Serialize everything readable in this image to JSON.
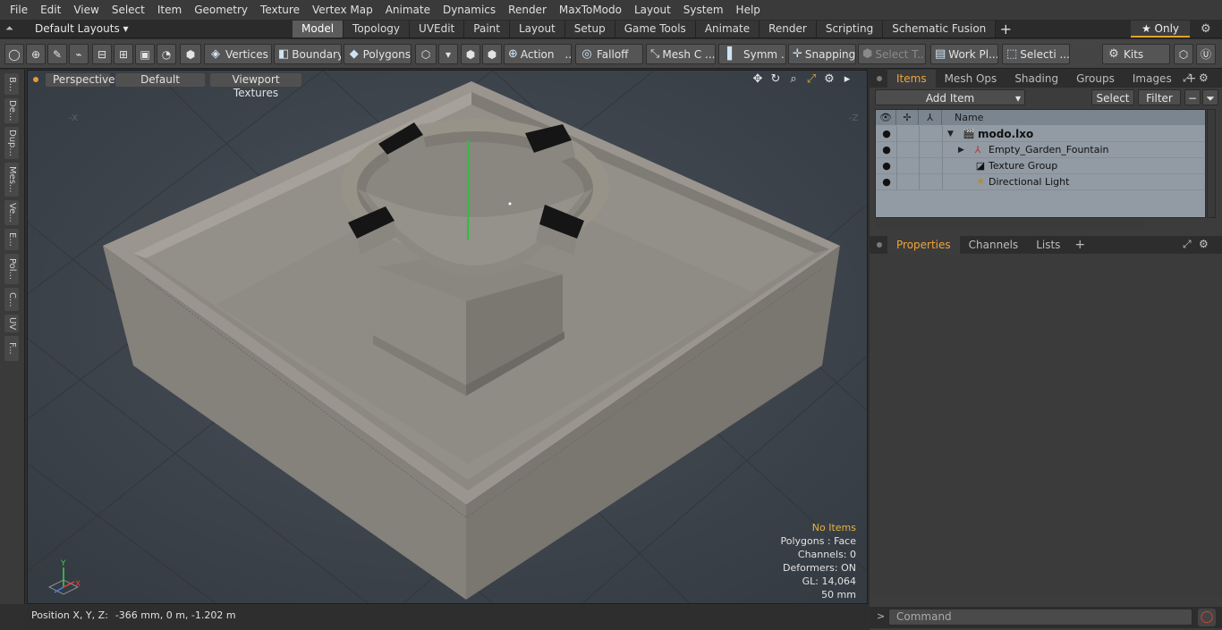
{
  "menu": [
    "File",
    "Edit",
    "View",
    "Select",
    "Item",
    "Geometry",
    "Texture",
    "Vertex Map",
    "Animate",
    "Dynamics",
    "Render",
    "MaxToModo",
    "Layout",
    "System",
    "Help"
  ],
  "layout_selector": "Default Layouts ▾",
  "layout_tabs": [
    "Model",
    "Topology",
    "UVEdit",
    "Paint",
    "Layout",
    "Setup",
    "Game Tools",
    "Animate",
    "Render",
    "Scripting",
    "Schematic Fusion"
  ],
  "layout_tab_add": "+",
  "only_button": "★  Only",
  "toolbar": {
    "vertices": "Vertices",
    "boundary": "Boundary",
    "polygons": "Polygons",
    "action": "Action",
    "action_more": "...",
    "falloff": "Falloff",
    "mesh": "Mesh C ...",
    "symmetry": "Symm ...",
    "snapping": "Snapping",
    "select_through": "Select T...",
    "work_plane": "Work Pl...",
    "selection": "Selecti ...",
    "kits": "Kits"
  },
  "left_strip": [
    "B...",
    "De...",
    "Dup...",
    "Mes...",
    "Ve...",
    "E...",
    "Pol...",
    "C...",
    "UV",
    "F..."
  ],
  "viewport": {
    "view": "Perspective",
    "shading": "Default",
    "textures": "Viewport Textures",
    "axis_labels": {
      "neg_x": "-X",
      "neg_z": "-Z"
    },
    "stats": {
      "no_items": "No Items",
      "polygons": "Polygons : Face",
      "channels": "Channels: 0",
      "deformers": "Deformers: ON",
      "gl": "GL: 14,064",
      "unit": "50 mm"
    },
    "gizmo": {
      "y": "Y",
      "x": "X"
    }
  },
  "status": {
    "label": "Position X, Y, Z:",
    "value": "-366 mm, 0 m, -1.202 m"
  },
  "items_panel": {
    "tabs": [
      "Items",
      "Mesh Ops",
      "Shading",
      "Groups",
      "Images"
    ],
    "add": "+",
    "add_item": "Add Item",
    "select": "Select",
    "filter": "Filter",
    "header_name": "Name",
    "rows": [
      {
        "label": "modo.lxo",
        "indent": 0
      },
      {
        "label": "Empty_Garden_Fountain",
        "indent": 1
      },
      {
        "label": "Texture Group",
        "indent": 1
      },
      {
        "label": "Directional Light",
        "indent": 1
      }
    ]
  },
  "properties_panel": {
    "tabs": [
      "Properties",
      "Channels",
      "Lists"
    ],
    "add": "+"
  },
  "command": {
    "prompt": ">",
    "placeholder": "Command"
  },
  "colors": {
    "accent": "#e3a52c",
    "viewport_bg": "#3b4148",
    "item_list_bg": "#929aa3",
    "fountain_stone": "#8e8a84"
  }
}
